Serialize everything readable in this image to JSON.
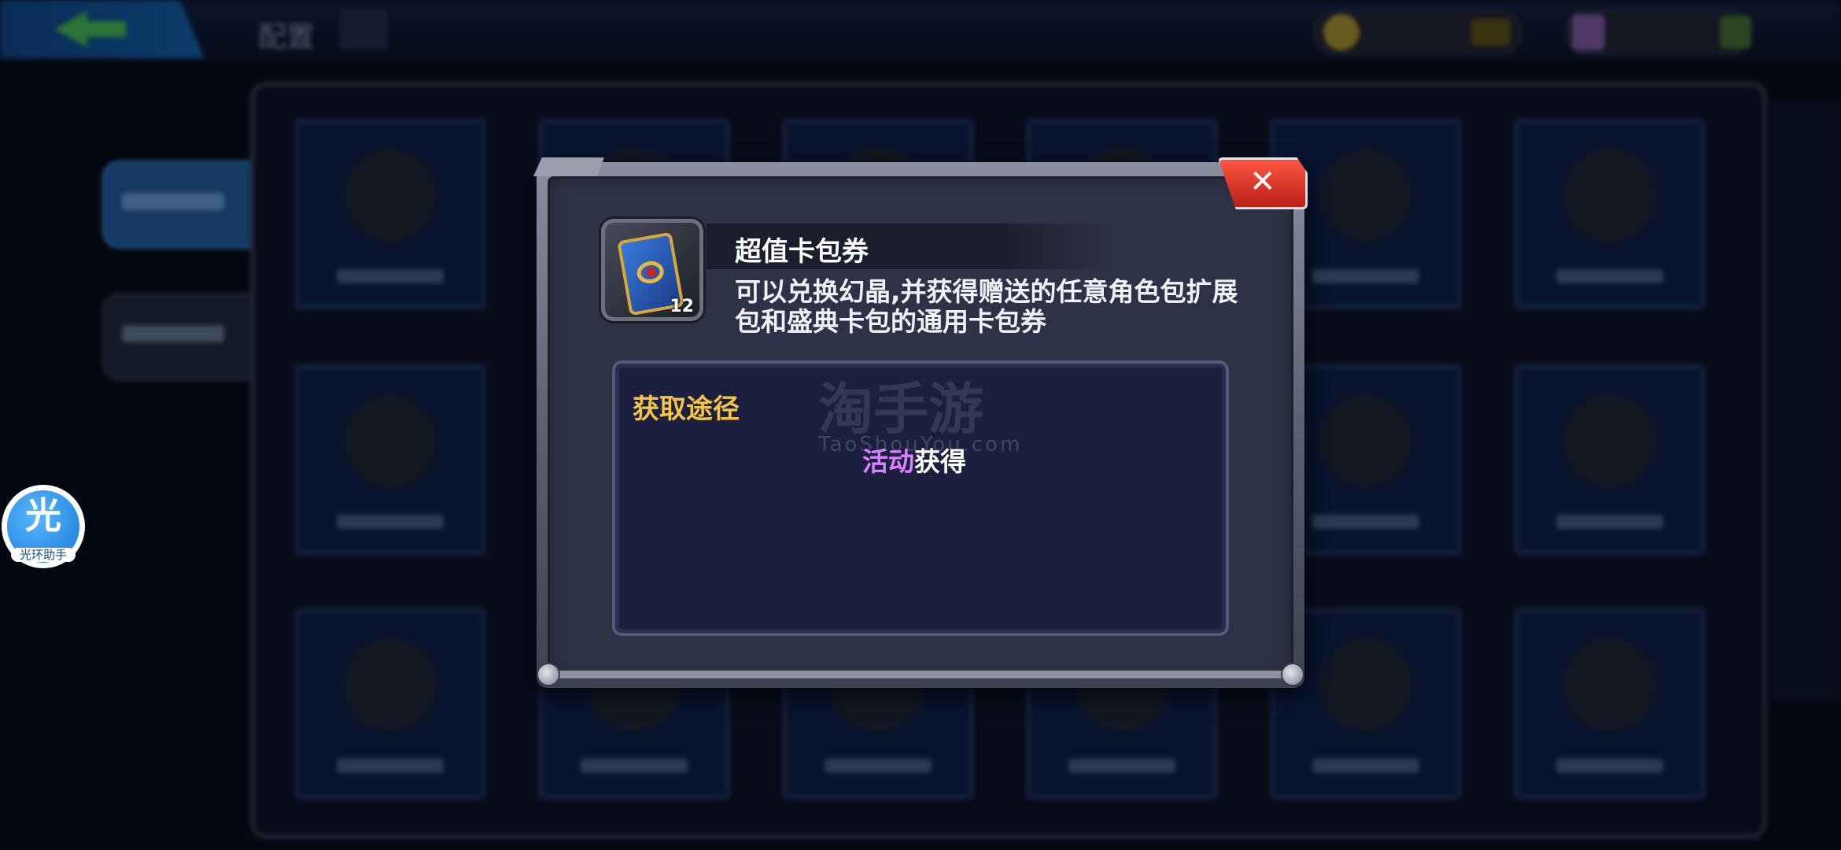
{
  "background": {
    "title": "配置",
    "colors": {
      "backdrop": "#070b17",
      "tile": "#0d1a3e"
    }
  },
  "modal": {
    "item": {
      "name": "超值卡包券",
      "count": "12",
      "description": "可以兑换幻晶,并获得赠送的任意角色包扩展包和盛典卡包的通用卡包券",
      "icon": "card-pack-ticket-icon"
    },
    "acquire": {
      "title": "获取途径",
      "source_highlight": "活动",
      "source_suffix": "获得"
    },
    "close_icon": "close-icon"
  },
  "watermark": {
    "main": "淘手游",
    "sub": "TaoShouYou.com"
  },
  "assistant": {
    "glyph": "光",
    "label": "光环助手"
  },
  "colors": {
    "title_gold": "#f2c545",
    "highlight_purple": "#d882ff",
    "close_red": "#e2382a"
  }
}
